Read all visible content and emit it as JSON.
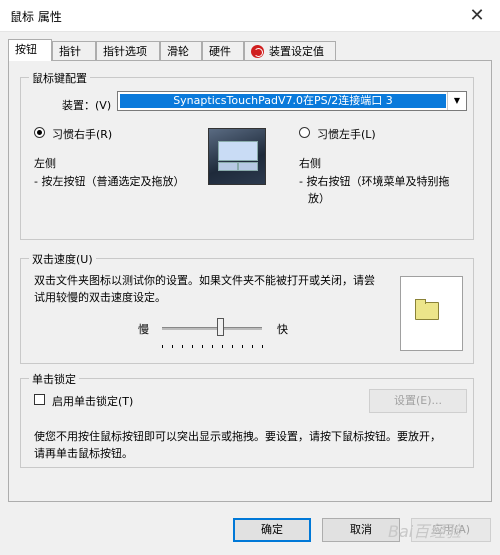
{
  "window": {
    "title": "鼠标 属性"
  },
  "tabs": [
    {
      "label": "按钮"
    },
    {
      "label": "指针"
    },
    {
      "label": "指针选项"
    },
    {
      "label": "滑轮"
    },
    {
      "label": "硬件"
    },
    {
      "label": "装置设定值"
    }
  ],
  "button_config": {
    "group_label": "鼠标键配置",
    "device_label": "装置：(V)",
    "device_value": "SynapticsTouchPadV7.0在PS/2连接端口 3",
    "right_hand_label": "习惯右手(R)",
    "left_hand_label": "习惯左手(L)",
    "right_hand_checked": true,
    "left_side_title": "左侧",
    "left_side_desc": "- 按左按钮（普通选定及拖放）",
    "right_side_title": "右侧",
    "right_side_desc_1": "- 按右按钮（环境菜单及特别拖",
    "right_side_desc_2": "放）"
  },
  "double_click": {
    "group_label": "双击速度(U)",
    "desc_1": "双击文件夹图标以测试你的设置。如果文件夹不能被打开或关闭，请尝",
    "desc_2": "试用较慢的双击速度设定。",
    "slow_label": "慢",
    "fast_label": "快",
    "speed_fraction": 0.58
  },
  "click_lock": {
    "group_label": "单击锁定",
    "enable_label": "启用单击锁定(T)",
    "enabled": false,
    "settings_button": "设置(E)...",
    "desc_1": "使您不用按住鼠标按钮即可以突出显示或拖拽。要设置，请按下鼠标按钮。要放开，",
    "desc_2": "请再单击鼠标按钮。"
  },
  "footer": {
    "ok": "确定",
    "cancel": "取消",
    "apply": "应用(A)"
  },
  "watermark": "Bai百经验"
}
